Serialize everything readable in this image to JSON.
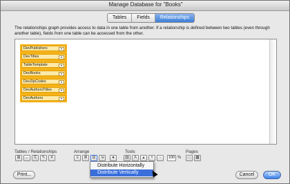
{
  "window": {
    "title": "Manage Database for \"Books\""
  },
  "tabs": [
    {
      "label": "Tables"
    },
    {
      "label": "Fields"
    },
    {
      "label": "Relationships"
    }
  ],
  "description": "The relationships graph provides access to data in one table from another. If a relationship is defined between two tables (even through another table), fields from one table can be accessed from the other.",
  "tables": [
    {
      "name": "DevPublishers"
    },
    {
      "name": "DevTitles"
    },
    {
      "name": "TableTemplate"
    },
    {
      "name": "DevBooks"
    },
    {
      "name": "DevZipCodes"
    },
    {
      "name": "DevAuthorsTitles"
    },
    {
      "name": "DevAuthors"
    }
  ],
  "toolbar": {
    "tables_relationships_label": "Tables / Relationships",
    "arrange_label": "Arrange",
    "tools_label": "Tools",
    "pages_label": "Pages",
    "zoom_value": "100",
    "zoom_unit": "%"
  },
  "arrange_menu": {
    "items": [
      {
        "label": "Distribute Horizontally"
      },
      {
        "label": "Distribute Vertically"
      }
    ]
  },
  "buttons": {
    "print": "Print...",
    "cancel": "Cancel",
    "ok": "OK"
  },
  "colors": {
    "accent": "#3a6fdb",
    "table_fill": "#fde9a8",
    "table_border": "#f5b21a"
  }
}
